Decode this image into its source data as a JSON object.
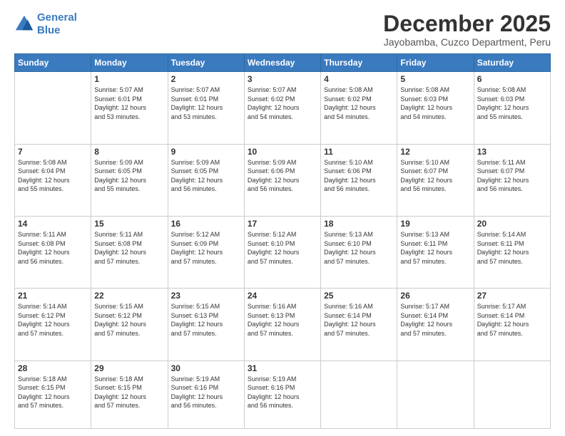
{
  "header": {
    "logo_line1": "General",
    "logo_line2": "Blue",
    "title": "December 2025",
    "subtitle": "Jayobamba, Cuzco Department, Peru"
  },
  "calendar": {
    "days_of_week": [
      "Sunday",
      "Monday",
      "Tuesday",
      "Wednesday",
      "Thursday",
      "Friday",
      "Saturday"
    ],
    "weeks": [
      [
        {
          "day": "",
          "info": ""
        },
        {
          "day": "1",
          "info": "Sunrise: 5:07 AM\nSunset: 6:01 PM\nDaylight: 12 hours\nand 53 minutes."
        },
        {
          "day": "2",
          "info": "Sunrise: 5:07 AM\nSunset: 6:01 PM\nDaylight: 12 hours\nand 53 minutes."
        },
        {
          "day": "3",
          "info": "Sunrise: 5:07 AM\nSunset: 6:02 PM\nDaylight: 12 hours\nand 54 minutes."
        },
        {
          "day": "4",
          "info": "Sunrise: 5:08 AM\nSunset: 6:02 PM\nDaylight: 12 hours\nand 54 minutes."
        },
        {
          "day": "5",
          "info": "Sunrise: 5:08 AM\nSunset: 6:03 PM\nDaylight: 12 hours\nand 54 minutes."
        },
        {
          "day": "6",
          "info": "Sunrise: 5:08 AM\nSunset: 6:03 PM\nDaylight: 12 hours\nand 55 minutes."
        }
      ],
      [
        {
          "day": "7",
          "info": "Sunrise: 5:08 AM\nSunset: 6:04 PM\nDaylight: 12 hours\nand 55 minutes."
        },
        {
          "day": "8",
          "info": "Sunrise: 5:09 AM\nSunset: 6:05 PM\nDaylight: 12 hours\nand 55 minutes."
        },
        {
          "day": "9",
          "info": "Sunrise: 5:09 AM\nSunset: 6:05 PM\nDaylight: 12 hours\nand 56 minutes."
        },
        {
          "day": "10",
          "info": "Sunrise: 5:09 AM\nSunset: 6:06 PM\nDaylight: 12 hours\nand 56 minutes."
        },
        {
          "day": "11",
          "info": "Sunrise: 5:10 AM\nSunset: 6:06 PM\nDaylight: 12 hours\nand 56 minutes."
        },
        {
          "day": "12",
          "info": "Sunrise: 5:10 AM\nSunset: 6:07 PM\nDaylight: 12 hours\nand 56 minutes."
        },
        {
          "day": "13",
          "info": "Sunrise: 5:11 AM\nSunset: 6:07 PM\nDaylight: 12 hours\nand 56 minutes."
        }
      ],
      [
        {
          "day": "14",
          "info": "Sunrise: 5:11 AM\nSunset: 6:08 PM\nDaylight: 12 hours\nand 56 minutes."
        },
        {
          "day": "15",
          "info": "Sunrise: 5:11 AM\nSunset: 6:08 PM\nDaylight: 12 hours\nand 57 minutes."
        },
        {
          "day": "16",
          "info": "Sunrise: 5:12 AM\nSunset: 6:09 PM\nDaylight: 12 hours\nand 57 minutes."
        },
        {
          "day": "17",
          "info": "Sunrise: 5:12 AM\nSunset: 6:10 PM\nDaylight: 12 hours\nand 57 minutes."
        },
        {
          "day": "18",
          "info": "Sunrise: 5:13 AM\nSunset: 6:10 PM\nDaylight: 12 hours\nand 57 minutes."
        },
        {
          "day": "19",
          "info": "Sunrise: 5:13 AM\nSunset: 6:11 PM\nDaylight: 12 hours\nand 57 minutes."
        },
        {
          "day": "20",
          "info": "Sunrise: 5:14 AM\nSunset: 6:11 PM\nDaylight: 12 hours\nand 57 minutes."
        }
      ],
      [
        {
          "day": "21",
          "info": "Sunrise: 5:14 AM\nSunset: 6:12 PM\nDaylight: 12 hours\nand 57 minutes."
        },
        {
          "day": "22",
          "info": "Sunrise: 5:15 AM\nSunset: 6:12 PM\nDaylight: 12 hours\nand 57 minutes."
        },
        {
          "day": "23",
          "info": "Sunrise: 5:15 AM\nSunset: 6:13 PM\nDaylight: 12 hours\nand 57 minutes."
        },
        {
          "day": "24",
          "info": "Sunrise: 5:16 AM\nSunset: 6:13 PM\nDaylight: 12 hours\nand 57 minutes."
        },
        {
          "day": "25",
          "info": "Sunrise: 5:16 AM\nSunset: 6:14 PM\nDaylight: 12 hours\nand 57 minutes."
        },
        {
          "day": "26",
          "info": "Sunrise: 5:17 AM\nSunset: 6:14 PM\nDaylight: 12 hours\nand 57 minutes."
        },
        {
          "day": "27",
          "info": "Sunrise: 5:17 AM\nSunset: 6:14 PM\nDaylight: 12 hours\nand 57 minutes."
        }
      ],
      [
        {
          "day": "28",
          "info": "Sunrise: 5:18 AM\nSunset: 6:15 PM\nDaylight: 12 hours\nand 57 minutes."
        },
        {
          "day": "29",
          "info": "Sunrise: 5:18 AM\nSunset: 6:15 PM\nDaylight: 12 hours\nand 57 minutes."
        },
        {
          "day": "30",
          "info": "Sunrise: 5:19 AM\nSunset: 6:16 PM\nDaylight: 12 hours\nand 56 minutes."
        },
        {
          "day": "31",
          "info": "Sunrise: 5:19 AM\nSunset: 6:16 PM\nDaylight: 12 hours\nand 56 minutes."
        },
        {
          "day": "",
          "info": ""
        },
        {
          "day": "",
          "info": ""
        },
        {
          "day": "",
          "info": ""
        }
      ]
    ]
  }
}
